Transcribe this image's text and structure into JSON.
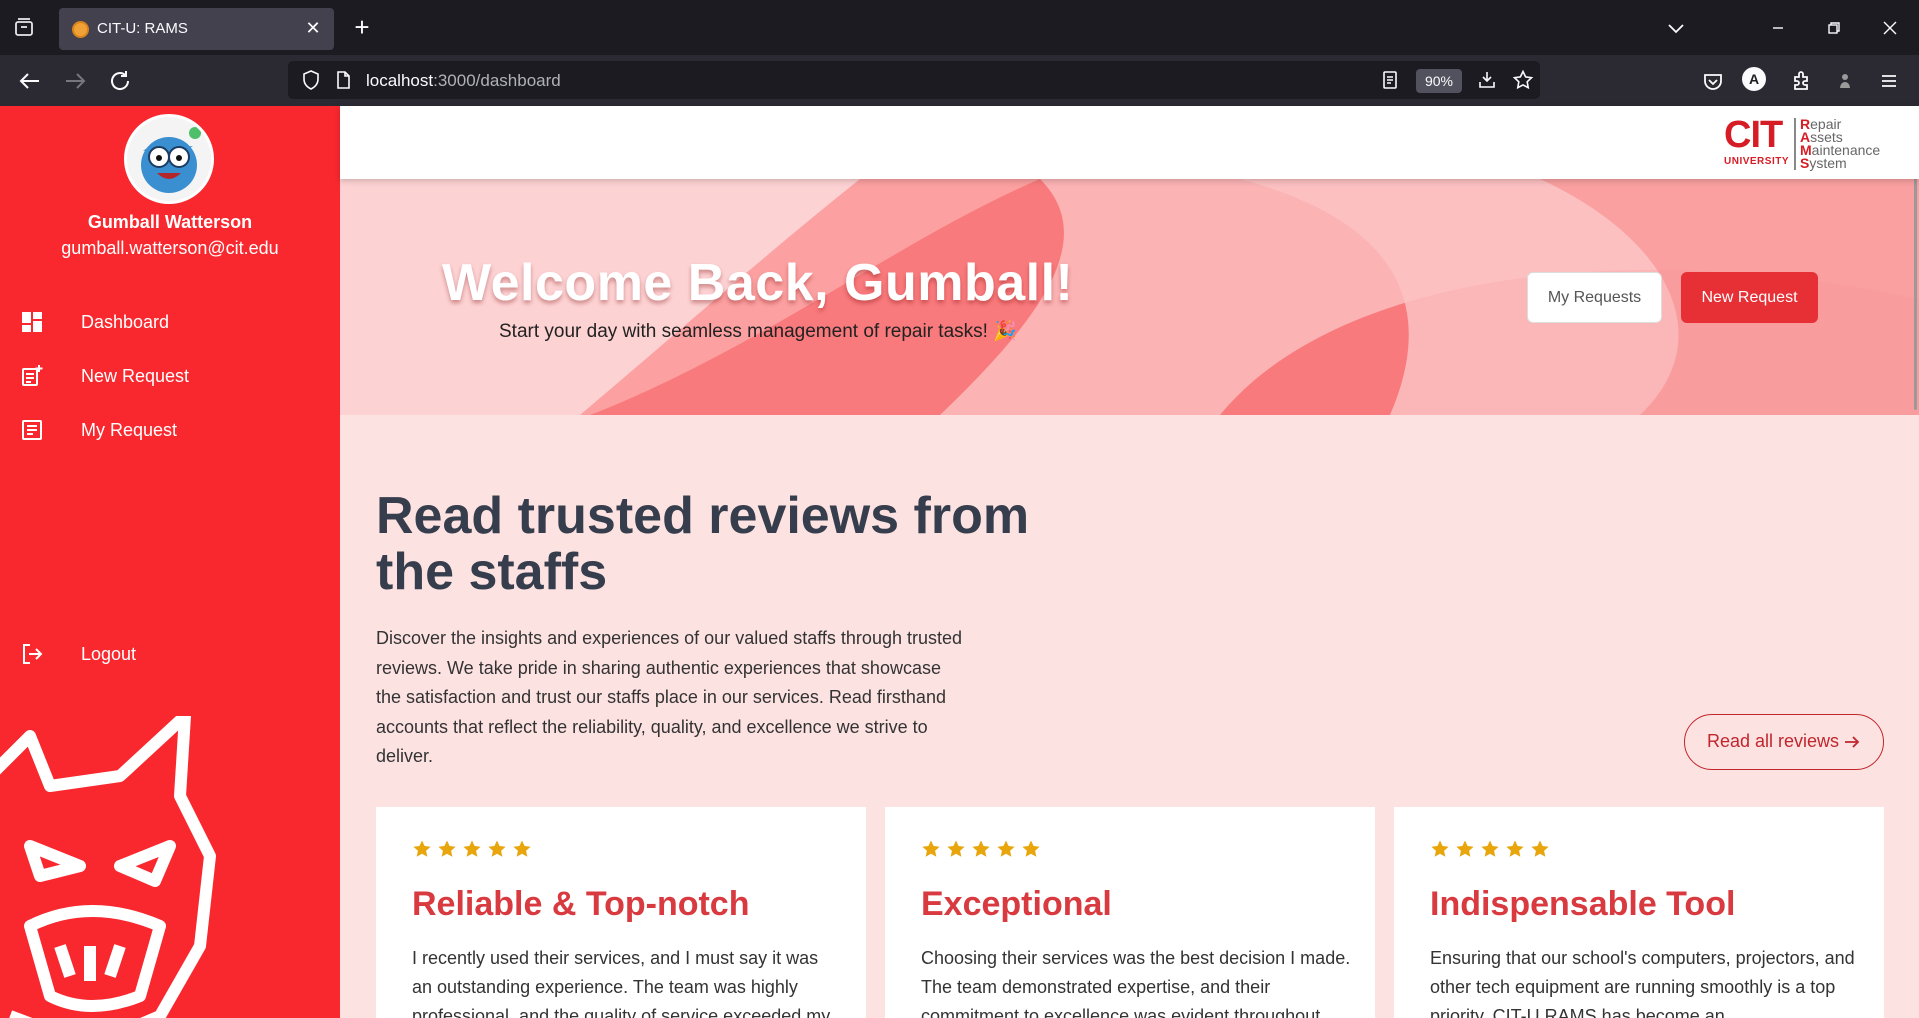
{
  "browser": {
    "tab_title": "CIT-U: RAMS",
    "url_host": "localhost",
    "url_path": ":3000/dashboard",
    "zoom": "90%",
    "account_initial": "A"
  },
  "sidebar": {
    "user_name": "Gumball Watterson",
    "user_email": "gumball.watterson@cit.edu",
    "items": [
      {
        "label": "Dashboard",
        "icon": "dashboard-icon"
      },
      {
        "label": "New Request",
        "icon": "new-request-icon"
      },
      {
        "label": "My Request",
        "icon": "my-request-icon"
      }
    ],
    "logout_label": "Logout"
  },
  "header": {
    "logo": {
      "cit": "CIT",
      "university": "UNIVERSITY",
      "lines": [
        {
          "initial": "R",
          "rest": "epair"
        },
        {
          "initial": "A",
          "rest": "ssets"
        },
        {
          "initial": "M",
          "rest": "aintenance"
        },
        {
          "initial": "S",
          "rest": "ystem"
        }
      ]
    }
  },
  "hero": {
    "title": "Welcome Back, Gumball!",
    "subtitle": "Start your day with seamless management of repair tasks! 🎉",
    "my_requests_label": "My Requests",
    "new_request_label": "New Request"
  },
  "reviews": {
    "title": "Read trusted reviews from the staffs",
    "description": "Discover the insights and experiences of our valued staffs through trusted reviews. We take pride in sharing authentic experiences that showcase the satisfaction and trust our staffs place in our services. Read firsthand accounts that reflect the reliability, quality, and excellence we strive to deliver.",
    "read_all_label": "Read all reviews",
    "cards": [
      {
        "rating": 5,
        "title": "Reliable & Top-notch",
        "body": "I recently used their services, and I must say it was an outstanding experience. The team was highly professional, and the quality of service exceeded my"
      },
      {
        "rating": 5,
        "title": "Exceptional",
        "body": "Choosing their services was the best decision I made. The team demonstrated expertise, and their commitment to excellence was evident throughout"
      },
      {
        "rating": 5,
        "title": "Indispensable Tool",
        "body": "Ensuring that our school's computers, projectors, and other tech equipment are running smoothly is a top priority. CIT-U RAMS has become an"
      }
    ]
  },
  "colors": {
    "sidebar_red": "#f8282e",
    "accent_red": "#e63035",
    "title_red": "#d83a3f",
    "star_gold": "#e8a50c",
    "page_bg": "#fde2e2"
  }
}
